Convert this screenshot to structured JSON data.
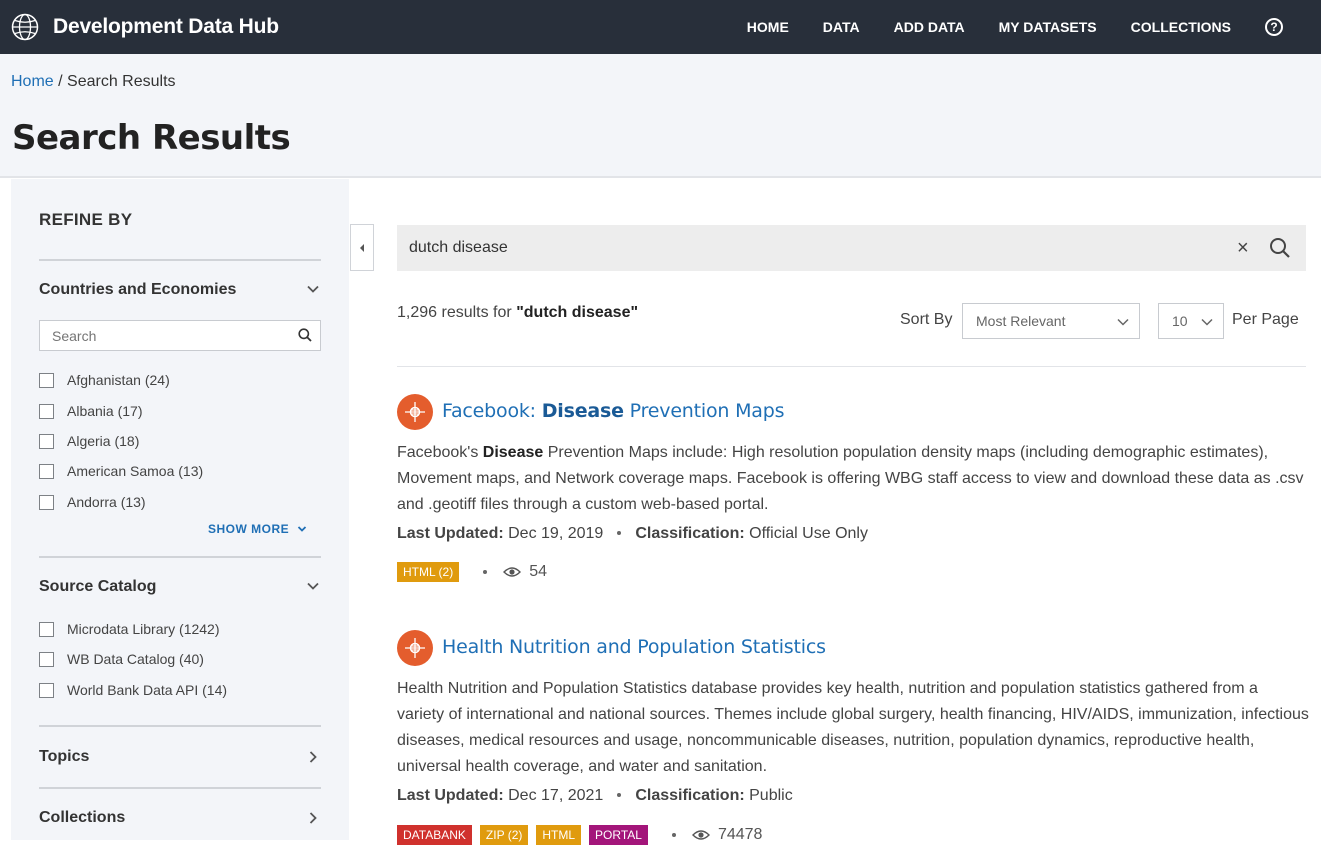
{
  "app": {
    "brand": "Development Data Hub"
  },
  "nav": [
    {
      "label": "HOME"
    },
    {
      "label": "DATA"
    },
    {
      "label": "ADD DATA"
    },
    {
      "label": "MY DATASETS"
    },
    {
      "label": "COLLECTIONS"
    }
  ],
  "breadcrumb": {
    "home": "Home",
    "separator": " / ",
    "current": "Search Results"
  },
  "page_title": "Search Results",
  "sidebar": {
    "heading": "REFINE BY",
    "countries": {
      "title": "Countries and Economies",
      "search_placeholder": "Search",
      "items": [
        {
          "label": "Afghanistan (24)"
        },
        {
          "label": "Albania (17)"
        },
        {
          "label": "Algeria (18)"
        },
        {
          "label": "American Samoa (13)"
        },
        {
          "label": "Andorra (13)"
        }
      ],
      "show_more": "SHOW MORE"
    },
    "source_catalog": {
      "title": "Source Catalog",
      "items": [
        {
          "label": "Microdata Library (1242)"
        },
        {
          "label": "WB Data Catalog (40)"
        },
        {
          "label": "World Bank Data API (14)"
        }
      ]
    },
    "topics": {
      "title": "Topics"
    },
    "collections": {
      "title": "Collections"
    }
  },
  "search": {
    "value": "dutch disease"
  },
  "results_summary": {
    "count": "1,296 results for",
    "query": "\"dutch disease\""
  },
  "sort": {
    "label": "Sort By",
    "value": "Most Relevant",
    "per_page_value": "10",
    "per_page_label": "Per Page"
  },
  "results": [
    {
      "title_prefix": "Facebook: ",
      "title_highlight": "Disease",
      "title_suffix": " Prevention Maps",
      "desc_prefix": "Facebook's ",
      "desc_highlight": "Disease",
      "desc_suffix": " Prevention Maps include: High resolution population density maps (including demographic estimates), Movement maps, and Network coverage maps. Facebook is offering WBG staff access to view and download these data as .csv and .geotiff files through a custom web-based portal.",
      "last_updated_label": "Last Updated:",
      "last_updated": "Dec 19, 2019",
      "classification_label": "Classification:",
      "classification": "Official Use Only",
      "tags": [
        {
          "label": "HTML (2)",
          "color": "#e09b0e"
        }
      ],
      "views": "54"
    },
    {
      "title": "Health Nutrition and Population Statistics",
      "desc": "Health Nutrition and Population Statistics database provides key health, nutrition and population statistics gathered from a variety of international and national sources. Themes include global surgery, health financing, HIV/AIDS, immunization, infectious diseases, medical resources and usage, noncommunicable diseases, nutrition, population dynamics, reproductive health, universal health coverage, and water and sanitation.",
      "last_updated_label": "Last Updated:",
      "last_updated": "Dec 17, 2021",
      "classification_label": "Classification:",
      "classification": "Public",
      "tags": [
        {
          "label": "DATABANK",
          "color": "#d0312d"
        },
        {
          "label": "ZIP (2)",
          "color": "#e09b0e"
        },
        {
          "label": "HTML",
          "color": "#e09b0e"
        },
        {
          "label": "PORTAL",
          "color": "#a3157a"
        }
      ],
      "views": "74478"
    }
  ]
}
